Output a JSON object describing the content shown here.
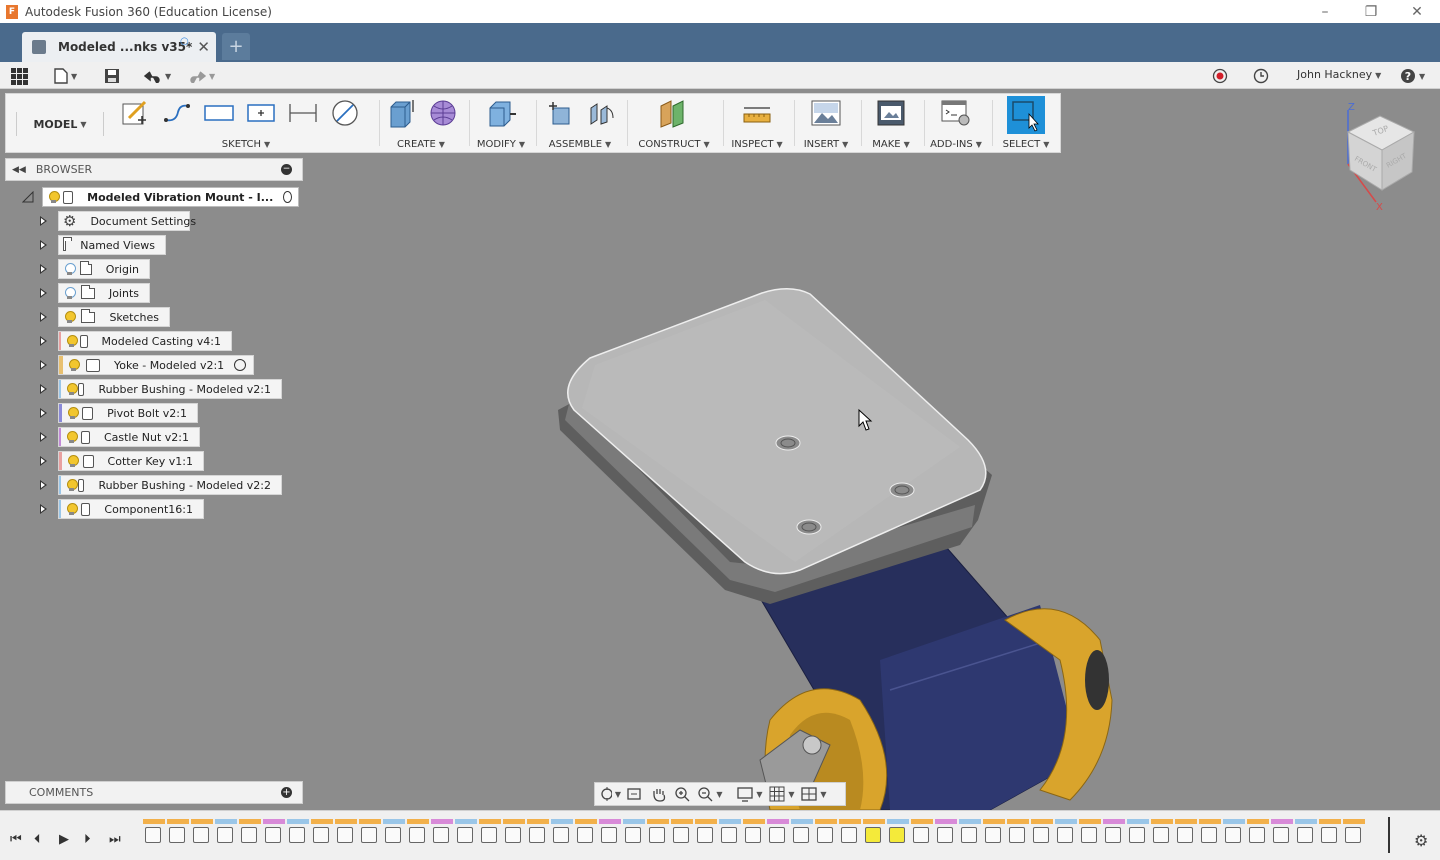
{
  "window": {
    "title": "Autodesk Fusion 360 (Education License)",
    "minimize": "–",
    "restore": "❐",
    "close": "✕"
  },
  "tab": {
    "label": "Modeled ...nks v35*",
    "close": "✕",
    "new_tab": "+"
  },
  "quick_access": {
    "user_name": "John Hackney"
  },
  "toolbar": {
    "workspace": "MODEL",
    "groups": {
      "sketch": "SKETCH",
      "create": "CREATE",
      "modify": "MODIFY",
      "assemble": "ASSEMBLE",
      "construct": "CONSTRUCT",
      "inspect": "INSPECT",
      "insert": "INSERT",
      "make": "MAKE",
      "addins": "ADD-INS",
      "select": "SELECT"
    }
  },
  "browser": {
    "header": "BROWSER",
    "root": "Modeled Vibration Mount - I...",
    "items": [
      {
        "label": "Document Settings"
      },
      {
        "label": "Named Views"
      },
      {
        "label": "Origin"
      },
      {
        "label": "Joints"
      },
      {
        "label": "Sketches"
      },
      {
        "label": "Modeled Casting v4:1"
      },
      {
        "label": "Yoke - Modeled v2:1"
      },
      {
        "label": "Rubber Bushing - Modeled v2:1"
      },
      {
        "label": "Pivot Bolt v2:1"
      },
      {
        "label": "Castle Nut v2:1"
      },
      {
        "label": "Cotter Key v1:1"
      },
      {
        "label": "Rubber Bushing - Modeled v2:2"
      },
      {
        "label": "Component16:1"
      }
    ]
  },
  "comments": {
    "header": "COMMENTS"
  },
  "viewcube": {
    "top": "TOP",
    "front": "FRONT",
    "right": "RIGHT",
    "z_axis": "Z",
    "x_axis": "X"
  },
  "colors": {
    "titlebar_bg": "#ffffff",
    "tabstrip_bg": "#4a6a8c",
    "viewport_bg": "#8c8c8c",
    "select_accent": "#1e90d8",
    "yoke_navy": "#27305e",
    "bushing_gold": "#d9a42c",
    "plate_gray": "#b8b8b8"
  }
}
